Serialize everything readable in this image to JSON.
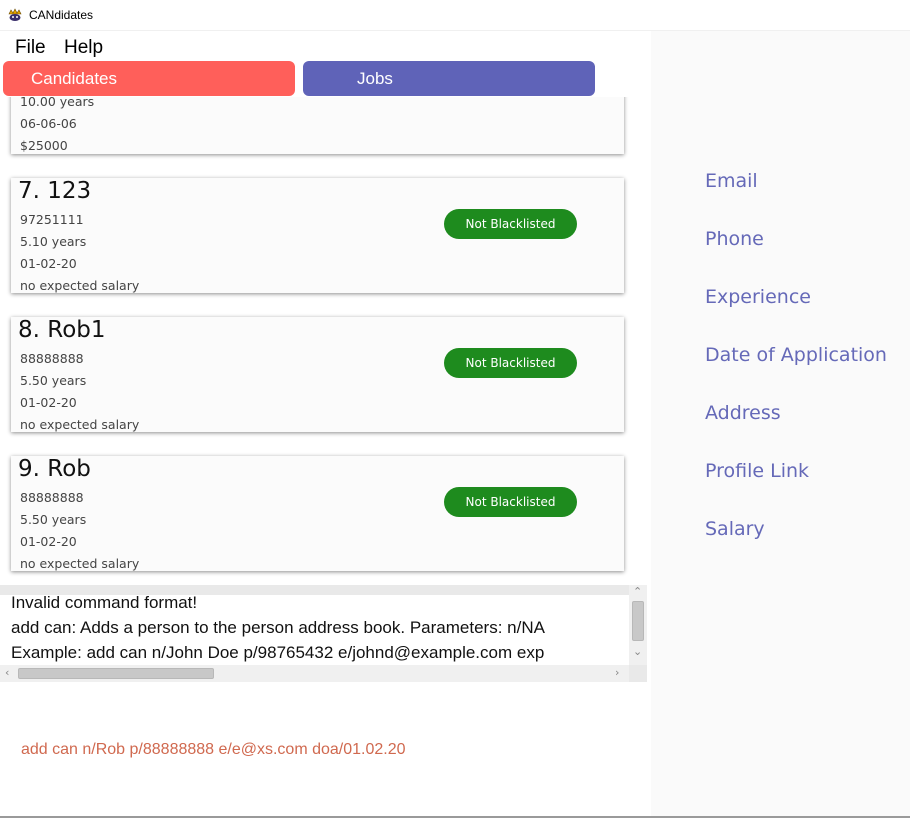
{
  "window": {
    "title": "CANdidates",
    "icon": "app-icon"
  },
  "menu": {
    "file": "File",
    "help": "Help"
  },
  "tabs": {
    "candidates": "Candidates",
    "jobs": "Jobs"
  },
  "cards": [
    {
      "name": "",
      "phone": "",
      "experience": "10.00 years",
      "date": "06-06-06",
      "salary": "$25000",
      "badge": ""
    },
    {
      "name": "7.  123",
      "phone": "97251111",
      "experience": "5.10 years",
      "date": "01-02-20",
      "salary": "no expected salary",
      "badge": "Not Blacklisted"
    },
    {
      "name": "8.  Rob1",
      "phone": "88888888",
      "experience": "5.50 years",
      "date": "01-02-20",
      "salary": "no expected salary",
      "badge": "Not Blacklisted"
    },
    {
      "name": "9.  Rob",
      "phone": "88888888",
      "experience": "5.50 years",
      "date": "01-02-20",
      "salary": "no expected salary",
      "badge": "Not Blacklisted"
    }
  ],
  "result": {
    "line1": "Invalid command format!",
    "line2": "add can: Adds a person to the person address book. Parameters: n/NA",
    "line3": "Example: add can n/John Doe p/98765432 e/johnd@example.com exp"
  },
  "command": {
    "value": "add can n/Rob p/88888888 e/e@xs.com doa/01.02.20"
  },
  "details": {
    "email": "Email",
    "phone": "Phone",
    "experience": "Experience",
    "date_of_application": "Date of Application",
    "address": "Address",
    "profile_link": "Profile Link",
    "salary": "Salary"
  },
  "colors": {
    "candidates_tab": "#ff5f5a",
    "jobs_tab": "#5f63b8",
    "badge": "#1e8b1e",
    "detail_label": "#6569b8",
    "command_text": "#d0694f"
  }
}
